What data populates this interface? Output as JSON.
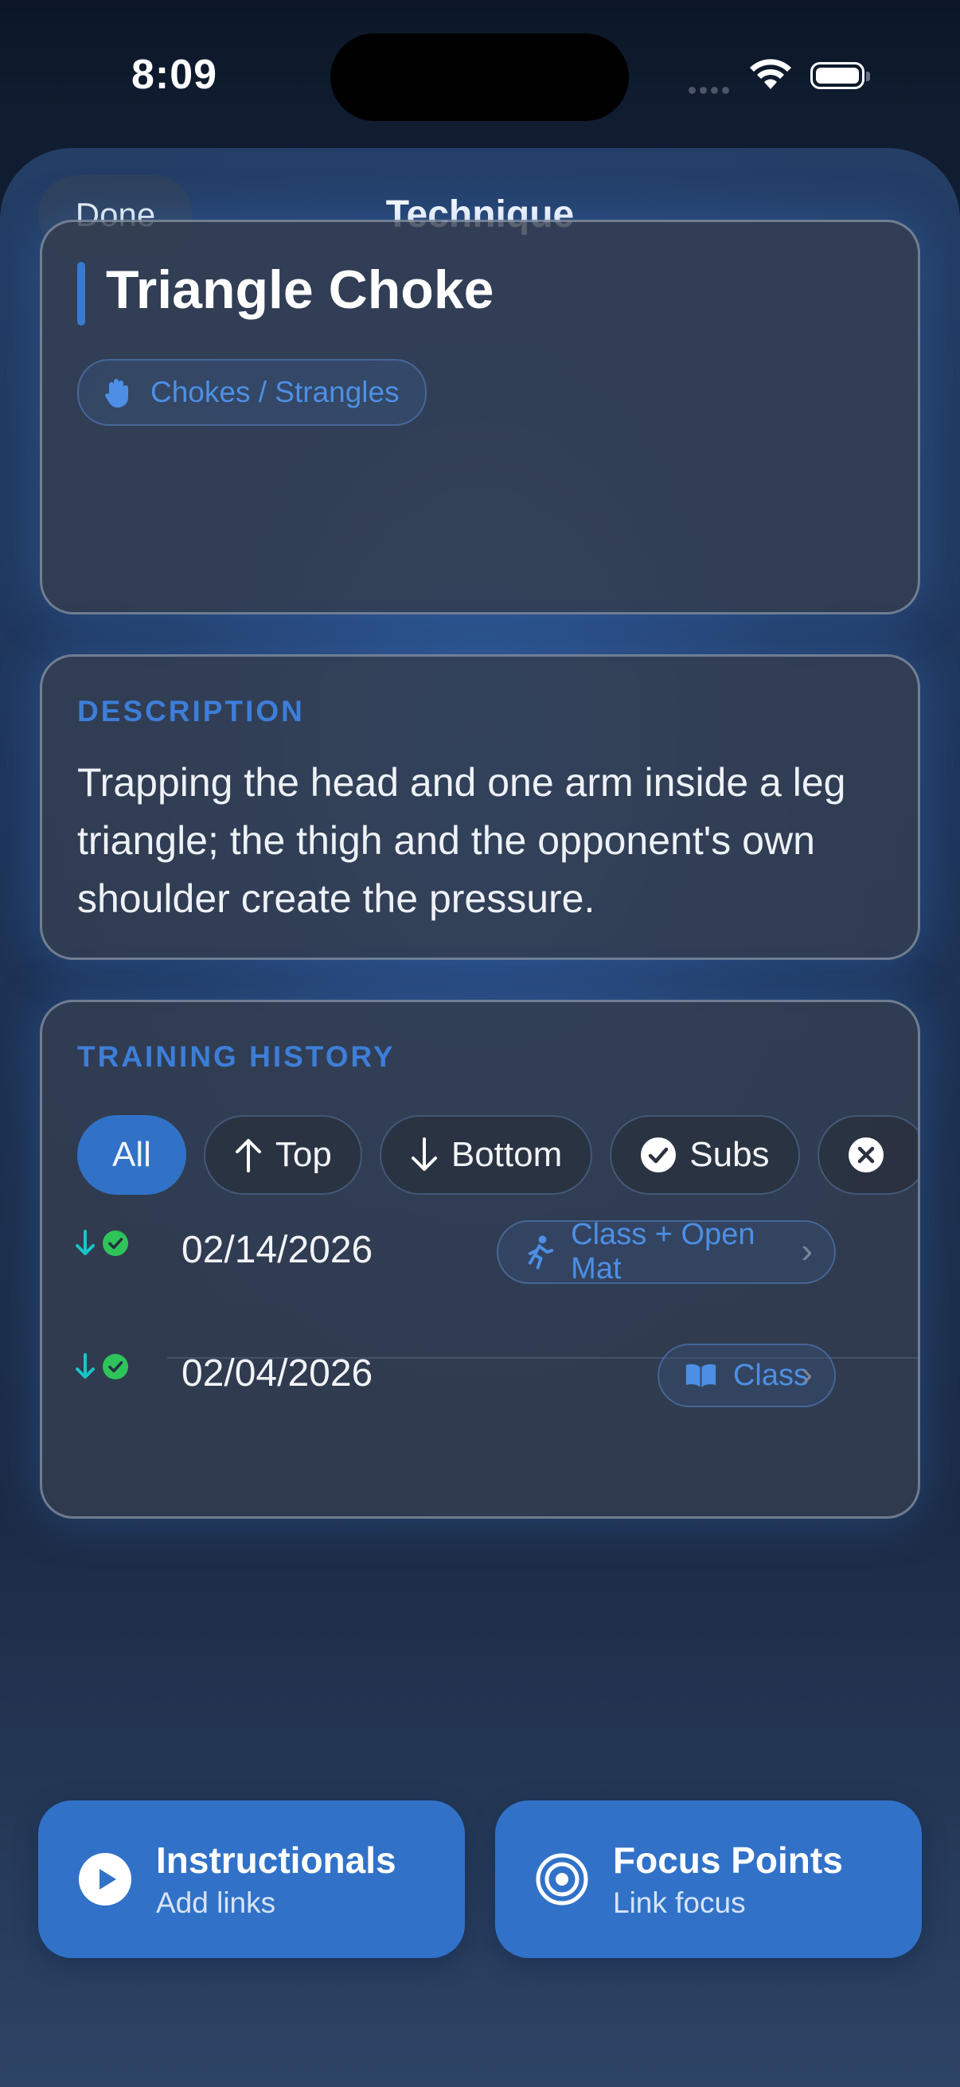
{
  "status_bar": {
    "time": "8:09"
  },
  "nav": {
    "done_label": "Done",
    "title": "Technique"
  },
  "technique": {
    "name": "Triangle Choke",
    "category": "Chokes / Strangles",
    "accent_color": "#3a7ad0"
  },
  "description": {
    "label": "DESCRIPTION",
    "text": "Trapping the head and one arm inside a leg triangle; the thigh and the opponent's own shoulder create the pressure."
  },
  "history": {
    "label": "TRAINING HISTORY",
    "filters": [
      {
        "label": "All",
        "icon": "none",
        "active": true
      },
      {
        "label": "Top",
        "icon": "arrow-up-icon",
        "active": false
      },
      {
        "label": "Bottom",
        "icon": "arrow-down-icon",
        "active": false
      },
      {
        "label": "Subs",
        "icon": "checkmark-circle-icon",
        "active": false
      },
      {
        "label": "",
        "icon": "x-circle-icon",
        "active": false
      }
    ],
    "entries": [
      {
        "date": "02/14/2026",
        "position_icon": "arrow-down-icon",
        "result_icon": "check-circle-icon",
        "session": "Class + Open Mat",
        "session_icon": "running-figure-icon"
      },
      {
        "date": "02/04/2026",
        "position_icon": "arrow-down-icon",
        "result_icon": "check-circle-icon",
        "session": "Class",
        "session_icon": "book-icon"
      }
    ]
  },
  "actions": {
    "instructionals": {
      "title": "Instructionals",
      "subtitle": "Add links"
    },
    "focus_points": {
      "title": "Focus Points",
      "subtitle": "Link focus"
    }
  }
}
